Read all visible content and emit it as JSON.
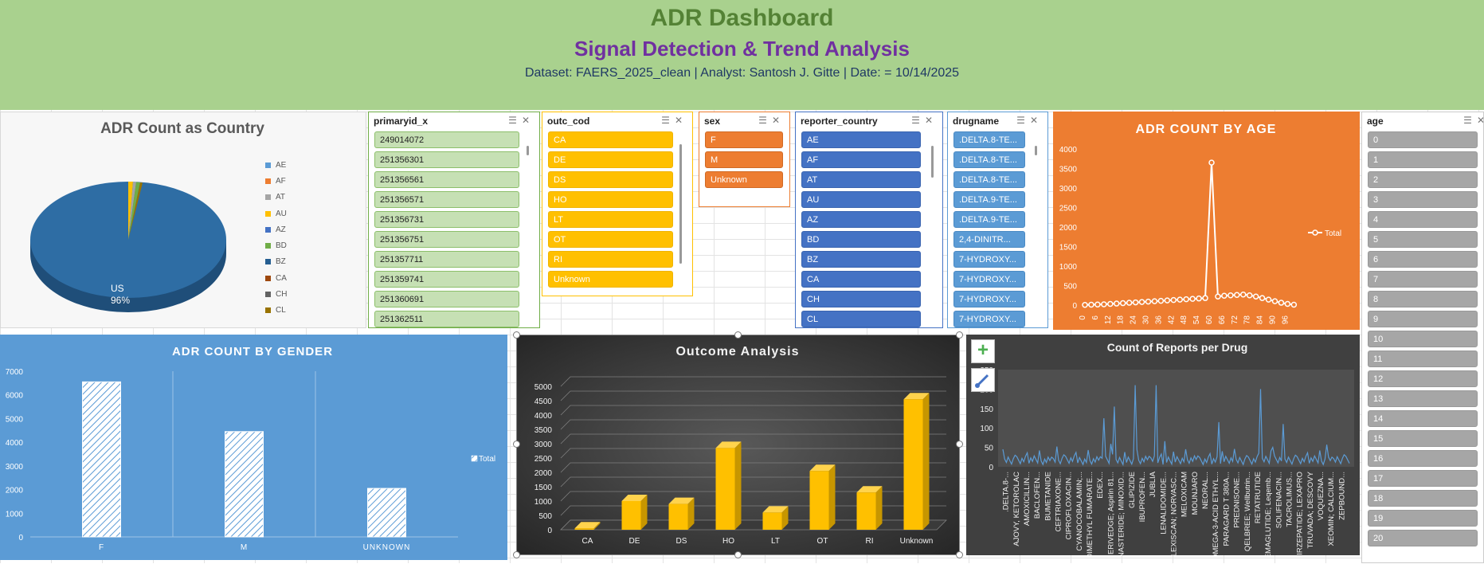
{
  "header": {
    "title": "ADR Dashboard",
    "subtitle": "Signal Detection & Trend Analysis",
    "info": "Dataset: FAERS_2025_clean |  Analyst: Santosh J. Gitte | Date: = 10/14/2025"
  },
  "country_pie": {
    "title": "ADR Count as Country",
    "legend": [
      "AE",
      "AF",
      "AT",
      "AU",
      "AZ",
      "BD",
      "BZ",
      "CA",
      "CH",
      "CL"
    ],
    "legend_colors": [
      "#5b9bd5",
      "#ed7d31",
      "#a5a5a5",
      "#ffc000",
      "#4472c4",
      "#70ad47",
      "#255e91",
      "#9e480e",
      "#636363",
      "#997300"
    ],
    "label_name": "US",
    "label_pct": "96%"
  },
  "slicers": {
    "primaryid": {
      "header": "primaryid_x",
      "items": [
        "249014072",
        "251356301",
        "251356561",
        "251356571",
        "251356731",
        "251356751",
        "251357711",
        "251359741",
        "251360691",
        "251362511"
      ]
    },
    "outc_cod": {
      "header": "outc_cod",
      "items": [
        "CA",
        "DE",
        "DS",
        "HO",
        "LT",
        "OT",
        "RI",
        "Unknown"
      ]
    },
    "sex": {
      "header": "sex",
      "items": [
        "F",
        "M",
        "Unknown"
      ]
    },
    "reporter_country": {
      "header": "reporter_country",
      "items": [
        "AE",
        "AF",
        "AT",
        "AU",
        "AZ",
        "BD",
        "BZ",
        "CA",
        "CH",
        "CL"
      ]
    },
    "drugname": {
      "header": "drugname",
      "items": [
        ".DELTA.8-TE...",
        ".DELTA.8-TE...",
        ".DELTA.8-TE...",
        ".DELTA.9-TE...",
        ".DELTA.9-TE...",
        "2,4-DINITR...",
        "7-HYDROXY...",
        "7-HYDROXY...",
        "7-HYDROXY...",
        "7-HYDROXY..."
      ]
    },
    "age": {
      "header": "age",
      "items": [
        "0",
        "1",
        "2",
        "3",
        "4",
        "5",
        "6",
        "7",
        "8",
        "9",
        "10",
        "11",
        "12",
        "13",
        "14",
        "15",
        "16",
        "17",
        "18",
        "19",
        "20"
      ]
    }
  },
  "colors": {
    "header_bg": "#a9d18e",
    "age_chart_bg": "#ed7d31",
    "gender_chart_bg": "#5b9bd5",
    "outcome_bar": "#ffc000",
    "drug_line": "#5b9bd5"
  },
  "chart_data": [
    {
      "type": "pie",
      "title": "ADR Count as Country",
      "categories": [
        "US",
        "AE",
        "AF",
        "AT",
        "AU",
        "AZ",
        "BD",
        "BZ",
        "CA",
        "CH",
        "CL"
      ],
      "values": [
        96,
        0.4,
        0.4,
        0.4,
        0.8,
        0.4,
        0.4,
        0.4,
        0.4,
        0.4,
        0.4
      ],
      "data_labels": [
        "US 96%"
      ]
    },
    {
      "type": "line",
      "title": "ADR COUNT BY AGE",
      "legend": [
        "Total"
      ],
      "yticks": [
        0,
        500,
        1000,
        1500,
        2000,
        2500,
        3000,
        3500,
        4000
      ],
      "ylim": [
        0,
        4000
      ],
      "xticks": [
        "0",
        "6",
        "12",
        "18",
        "24",
        "30",
        "36",
        "42",
        "48",
        "54",
        "60",
        "66",
        "72",
        "78",
        "84",
        "90",
        "96"
      ],
      "x": [
        0,
        3,
        6,
        9,
        12,
        15,
        18,
        21,
        24,
        27,
        30,
        33,
        36,
        39,
        42,
        45,
        48,
        51,
        54,
        57,
        60,
        63,
        66,
        69,
        72,
        75,
        78,
        81,
        84,
        87,
        90,
        93,
        96,
        99
      ],
      "series": [
        {
          "name": "Total",
          "values": [
            5,
            10,
            15,
            20,
            30,
            40,
            50,
            60,
            70,
            80,
            90,
            100,
            110,
            120,
            130,
            140,
            150,
            160,
            170,
            180,
            3650,
            220,
            240,
            250,
            260,
            270,
            250,
            220,
            180,
            140,
            100,
            60,
            30,
            10
          ]
        }
      ]
    },
    {
      "type": "bar",
      "title": "ADR COUNT BY GENDER",
      "categories": [
        "F",
        "M",
        "UNKNOWN"
      ],
      "series": [
        {
          "name": "Total",
          "values": [
            6550,
            4450,
            2050
          ]
        }
      ],
      "yticks": [
        0,
        1000,
        2000,
        3000,
        4000,
        5000,
        6000,
        7000
      ],
      "ylim": [
        0,
        7000
      ]
    },
    {
      "type": "bar",
      "title": "Outcome Analysis",
      "categories": [
        "CA",
        "DE",
        "DS",
        "HO",
        "LT",
        "OT",
        "RI",
        "Unknown"
      ],
      "values": [
        50,
        1000,
        900,
        2850,
        600,
        2050,
        1300,
        4550
      ],
      "yticks": [
        0,
        500,
        1000,
        1500,
        2000,
        2500,
        3000,
        3500,
        4000,
        4500,
        5000
      ],
      "ylim": [
        0,
        5000
      ]
    },
    {
      "type": "line",
      "title": "Count of Reports per Drug",
      "yticks": [
        0,
        50,
        100,
        150,
        200,
        250
      ],
      "ylim": [
        0,
        250
      ],
      "categories": [
        ".DELTA.8-...",
        "AJOVY, KETOROLAC",
        "AMOXICILLIN...",
        "BACLOFEN...",
        "BUMETANIDE",
        "CEFTRIAXONE...",
        "CIPROFLOXACIN...",
        "CYANOCOBALAMIN;...",
        "DIMETHYL FUMARATE...",
        "EDEX...",
        "ERIVEDGE; Aspirin 81...",
        "FINASTERIDE; MINOXID...",
        "GLIPIZIDE",
        "IBUPROFEN...",
        "JUBLIA",
        "LENALIDOMIDE...",
        "LEXISCAN; NORVASC...",
        "MELOXICAM",
        "MOUNJARO",
        "NEORAL...",
        "OMEGA-3-ACID ETHYL...",
        "PARAGARD T 380A...",
        "PREDNISONE...",
        "QELBREE; Wellbutrin...",
        "RETATRUTIDE",
        "SEMAGLUTIDE; Leqemb...",
        "SOLIFENACIN...",
        "TACROLIMUS...",
        "TIRZEPATIDE; LEXAPRO",
        "TRUVADA; DESCOVY",
        "VOQUEZNA...",
        "XEOMIN; CALCIUM...",
        "ZEPBOUND..."
      ],
      "spikes": [
        {
          "label": "EDEX...",
          "value": 125
        },
        {
          "label": "ERIVEDGE; Aspirin 81...",
          "value": 155
        },
        {
          "label": "GLIPIZIDE",
          "value": 210
        },
        {
          "label": "JUBLIA",
          "value": 210
        },
        {
          "label": "OMEGA-3-ACID ETHYL...",
          "value": 115
        },
        {
          "label": "RETATRUTIDE",
          "value": 200
        },
        {
          "label": "SOLIFENACIN...",
          "value": 110
        }
      ]
    }
  ]
}
